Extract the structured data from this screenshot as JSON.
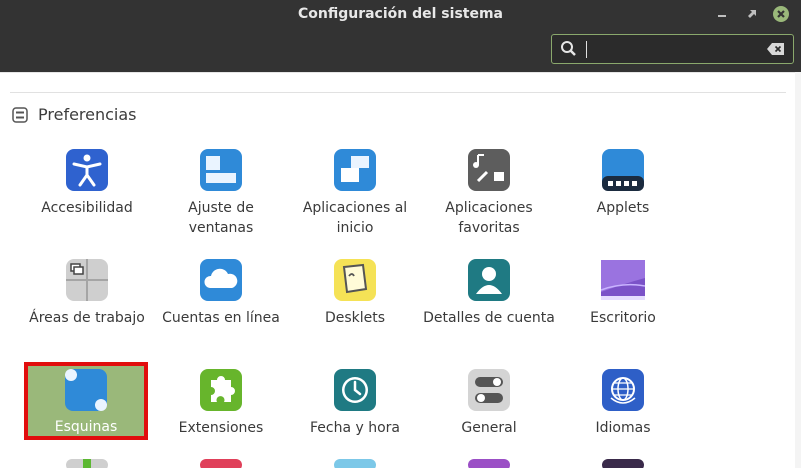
{
  "window": {
    "title": "Configuración del sistema"
  },
  "search": {
    "value": "",
    "placeholder": ""
  },
  "section": {
    "label": "Preferencias"
  },
  "items": [
    {
      "label": "Accesibilidad",
      "icon": "accessibility-icon"
    },
    {
      "label": "Ajuste de ventanas",
      "icon": "window-tiling-icon"
    },
    {
      "label": "Aplicaciones al inicio",
      "icon": "startup-apps-icon"
    },
    {
      "label": "Aplicaciones favoritas",
      "icon": "preferred-apps-icon"
    },
    {
      "label": "Applets",
      "icon": "applets-icon"
    },
    {
      "label": "Áreas de trabajo",
      "icon": "workspaces-icon"
    },
    {
      "label": "Cuentas en línea",
      "icon": "cloud-icon"
    },
    {
      "label": "Desklets",
      "icon": "desklets-icon"
    },
    {
      "label": "Detalles de cuenta",
      "icon": "user-icon"
    },
    {
      "label": "Escritorio",
      "icon": "desktop-icon"
    },
    {
      "label": "Esquinas activas",
      "icon": "hot-corners-icon",
      "selected": true
    },
    {
      "label": "Extensiones",
      "icon": "puzzle-icon"
    },
    {
      "label": "Fecha y hora",
      "icon": "clock-icon"
    },
    {
      "label": "General",
      "icon": "toggles-icon"
    },
    {
      "label": "Idiomas",
      "icon": "globe-icon"
    }
  ],
  "colors": {
    "accent": "#9ab87a",
    "highlight_border": "#e10d0d",
    "titlebar": "#333333"
  }
}
